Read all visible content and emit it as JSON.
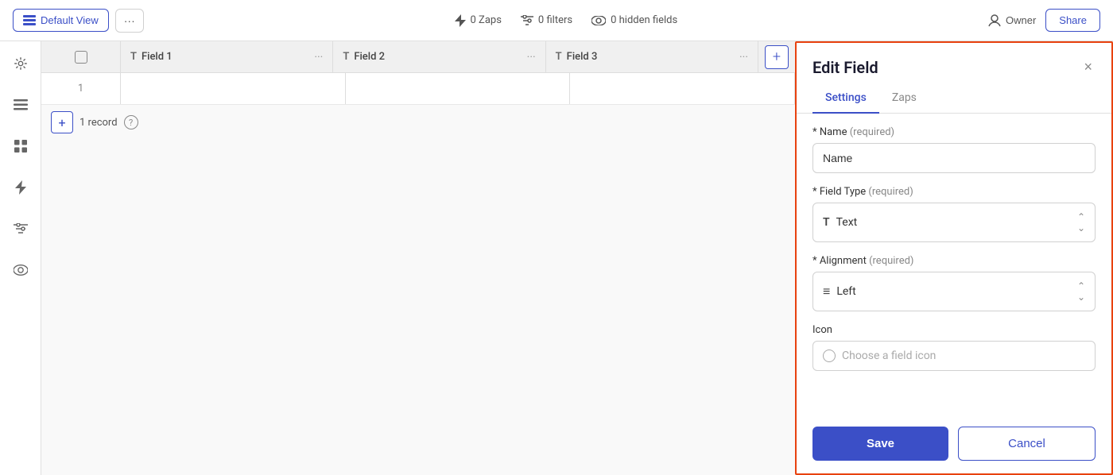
{
  "topbar": {
    "default_view_label": "Default View",
    "more_label": "···",
    "zaps_label": "0 Zaps",
    "filters_label": "0 filters",
    "hidden_fields_label": "0 hidden fields",
    "owner_label": "Owner",
    "share_label": "Share"
  },
  "sidebar": {
    "icons": [
      "settings",
      "list",
      "grid",
      "zap",
      "filter",
      "eye"
    ]
  },
  "table": {
    "columns": [
      {
        "label": "Field 1",
        "icon": "T"
      },
      {
        "label": "Field 2",
        "icon": "T"
      },
      {
        "label": "Field 3",
        "icon": "T"
      }
    ],
    "add_button": "+",
    "row_number": "1",
    "footer_add": "+",
    "record_count": "1 record"
  },
  "edit_field": {
    "title": "Edit Field",
    "close_label": "×",
    "tabs": [
      {
        "label": "Settings"
      },
      {
        "label": "Zaps"
      }
    ],
    "active_tab": "Settings",
    "name_label": "* Name",
    "name_required": "(required)",
    "name_placeholder": "Name",
    "name_value": "Name",
    "field_type_label": "* Field Type",
    "field_type_required": "(required)",
    "field_type_value": "Text",
    "field_type_icon": "T",
    "alignment_label": "* Alignment",
    "alignment_required": "(required)",
    "alignment_value": "Left",
    "alignment_icon": "≡",
    "icon_label": "Icon",
    "icon_placeholder": "Choose a field icon",
    "save_label": "Save",
    "cancel_label": "Cancel"
  }
}
